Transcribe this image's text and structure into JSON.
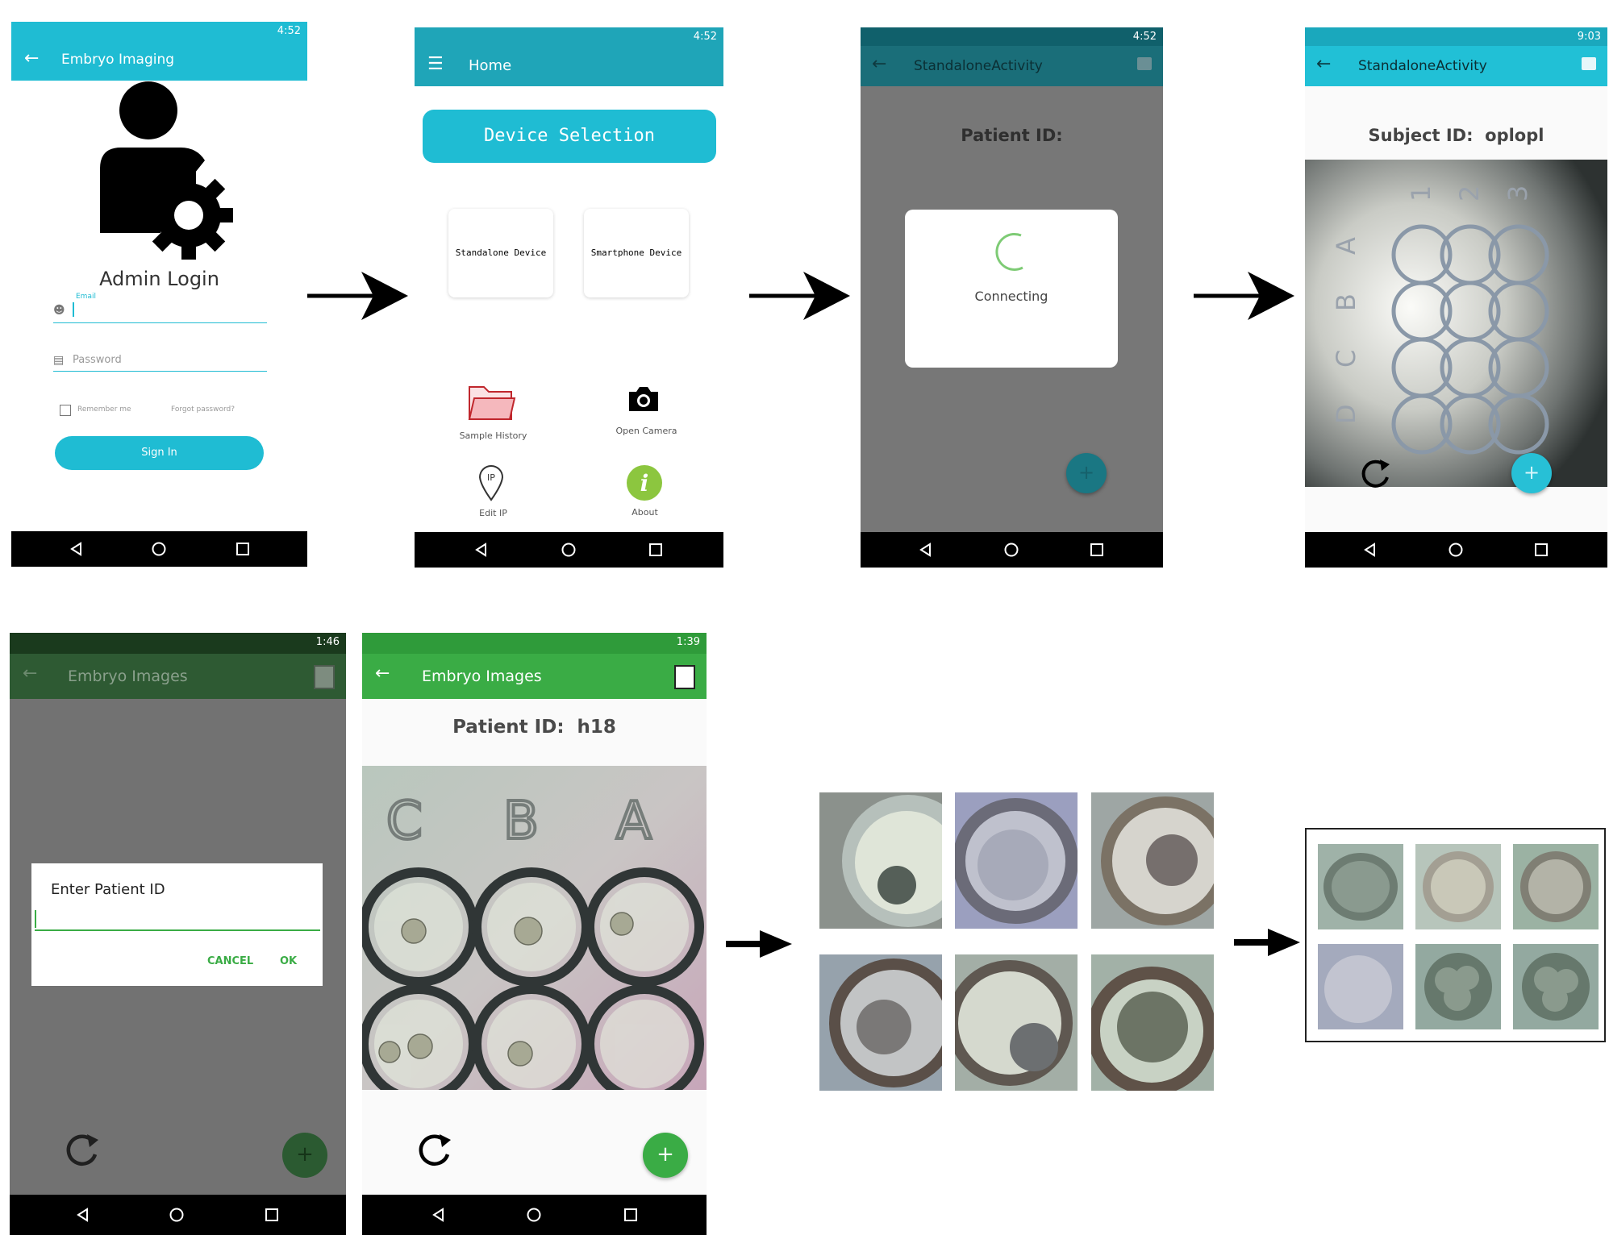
{
  "colors": {
    "cyan": "#1fbcd3",
    "cyan_dark": "#1f8c9e",
    "teal_dim": "#1d6f7b",
    "green": "#3aac45",
    "green_dim": "#2e5d33",
    "gray_overlay": "#747474"
  },
  "status": {
    "time_452": "4:52",
    "time_903": "9:03",
    "time_146": "1:46",
    "time_139": "1:39"
  },
  "screen1": {
    "title": "Embryo Imaging",
    "admin_label": "Admin Login",
    "email_label": "Email",
    "password_placeholder": "Password",
    "remember": "Remember me",
    "forgot": "Forgot password?",
    "signin": "Sign In"
  },
  "screen2": {
    "title": "Home",
    "device_selection": "Device Selection",
    "standalone": "Standalone Device",
    "smartphone": "Smartphone Device",
    "sample_history": "Sample History",
    "open_camera": "Open Camera",
    "edit_ip": "Edit IP",
    "about": "About"
  },
  "screen3": {
    "title": "StandaloneActivity",
    "patient_label": "Patient ID:",
    "connecting": "Connecting"
  },
  "screen4": {
    "title": "StandaloneActivity",
    "subject_label": "Subject ID:",
    "subject_value": "oplopl"
  },
  "screen5": {
    "title": "Embryo Images",
    "dialog_title": "Enter Patient ID",
    "cancel": "CANCEL",
    "ok": "OK"
  },
  "screen6": {
    "title": "Embryo Images",
    "patient_label": "Patient ID:",
    "patient_value": "h18",
    "well_letters": [
      "C",
      "B",
      "A"
    ]
  },
  "plate_letters": [
    "A",
    "B",
    "C",
    "D"
  ],
  "plate_numbers": [
    "1",
    "2",
    "3"
  ],
  "icons": [
    "back-arrow-icon",
    "menu-icon",
    "image-icon",
    "refresh-icon",
    "add-icon",
    "camera-icon",
    "folder-icon",
    "location-pin-icon",
    "info-icon",
    "gear-icon",
    "user-icon",
    "lock-icon"
  ]
}
